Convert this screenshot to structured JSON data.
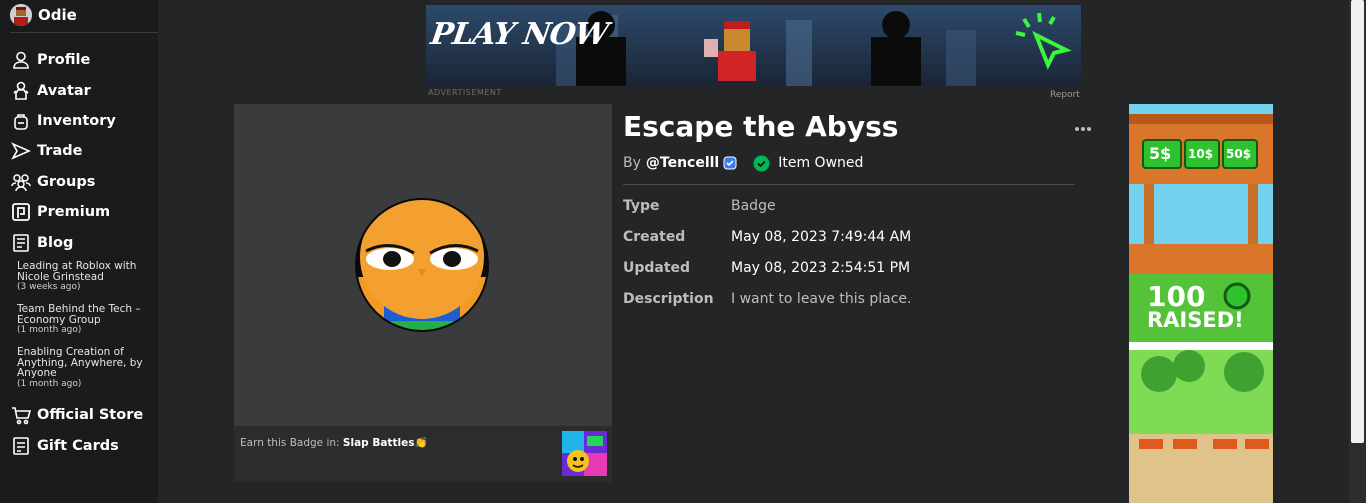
{
  "user": {
    "name": "Odie"
  },
  "nav": {
    "items": [
      {
        "label": "Profile",
        "icon": "profile-icon"
      },
      {
        "label": "Avatar",
        "icon": "avatar-icon"
      },
      {
        "label": "Inventory",
        "icon": "inventory-icon"
      },
      {
        "label": "Trade",
        "icon": "trade-icon"
      },
      {
        "label": "Groups",
        "icon": "groups-icon"
      },
      {
        "label": "Premium",
        "icon": "premium-icon"
      },
      {
        "label": "Blog",
        "icon": "blog-icon"
      }
    ],
    "blog_posts": [
      {
        "title": "Leading at Roblox with Nicole Grinstead",
        "age": "(3 weeks ago)"
      },
      {
        "title": "Team Behind the Tech – Economy Group",
        "age": "(1 month ago)"
      },
      {
        "title": "Enabling Creation of Anything, Anywhere, by Anyone",
        "age": "(1 month ago)"
      }
    ],
    "bottom_items": [
      {
        "label": "Official Store",
        "icon": "cart-icon"
      },
      {
        "label": "Gift Cards",
        "icon": "gift-card-icon"
      }
    ]
  },
  "top_ad": {
    "headline": "PLAY NOW",
    "caption": "ADVERTISEMENT",
    "report": "Report"
  },
  "item": {
    "title": "Escape the Abyss",
    "by_prefix": "By",
    "creator": "@Tencelll",
    "owned_status": "Item Owned",
    "details": [
      {
        "label": "Type",
        "value": "Badge"
      },
      {
        "label": "Created",
        "value": "May 08, 2023 7:49:44 AM"
      },
      {
        "label": "Updated",
        "value": "May 08, 2023 2:54:51 PM"
      },
      {
        "label": "Description",
        "value": "I want to leave this place."
      }
    ],
    "earn_prefix": "Earn this Badge in:",
    "earn_game": "Slap Battles👏"
  },
  "right_ad": {
    "prices": [
      "5$",
      "10$",
      "50$"
    ],
    "amount": "100",
    "raised": "RAISED!"
  },
  "colors": {
    "page_bg": "#232527",
    "sidebar_bg": "#191b1d",
    "verified_blue": "#3b7cf2",
    "owned_green": "#02b757"
  }
}
